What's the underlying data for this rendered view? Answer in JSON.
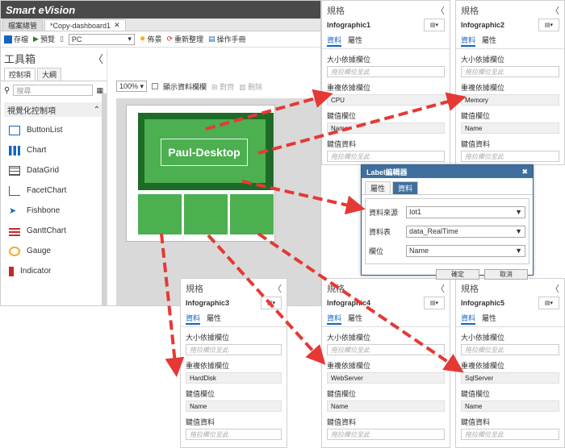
{
  "app": {
    "title": "Smart eVision",
    "tabs": [
      "檔案總管",
      "*Copy-dashboard1"
    ],
    "toolbar": {
      "save": "存檔",
      "preview": "預覽",
      "device": "PC",
      "theme": "佈景",
      "resort": "重新整理",
      "manual": "操作手冊"
    },
    "toolbox": {
      "title": "工具箱",
      "collapse": "〈",
      "tabs": [
        "控制項",
        "大綱"
      ],
      "search_placeholder": "搜尋",
      "section": "視覺化控制項",
      "items": [
        "ButtonList",
        "Chart",
        "DataGrid",
        "FacetChart",
        "Fishbone",
        "GanttChart",
        "Gauge",
        "Indicator"
      ]
    },
    "canvas": {
      "zoom": "100%",
      "show_grid": "顯示資料欄欄",
      "align": "對齊",
      "delete": "刪除",
      "tile_label": "Paul-Desktop"
    }
  },
  "panels": [
    {
      "title": "規格",
      "comp": "Infographic1",
      "tabs": [
        "資料",
        "屬性"
      ],
      "size_label": "大小依據欄位",
      "size_ph": "拖拉欄位至此",
      "weight_label": "重複依據欄位",
      "weight_value": "CPU",
      "key_label": "鍵值欄位",
      "key_value": "Name",
      "keydata_label": "鍵值資料",
      "keydata_ph": "拖拉欄位至此"
    },
    {
      "title": "規格",
      "comp": "Infographic2",
      "tabs": [
        "資料",
        "屬性"
      ],
      "size_label": "大小依據欄位",
      "size_ph": "拖拉欄位至此",
      "weight_label": "重複依據欄位",
      "weight_value": "Memory",
      "key_label": "鍵值欄位",
      "key_value": "Name",
      "keydata_label": "鍵值資料",
      "keydata_ph": "拖拉欄位至此"
    },
    {
      "title": "規格",
      "comp": "Infographic3",
      "tabs": [
        "資料",
        "屬性"
      ],
      "size_label": "大小依據欄位",
      "size_ph": "拖拉欄位至此",
      "weight_label": "重複依據欄位",
      "weight_value": "HardDisk",
      "key_label": "鍵值欄位",
      "key_value": "Name",
      "keydata_label": "鍵值資料",
      "keydata_ph": "拖拉欄位至此"
    },
    {
      "title": "規格",
      "comp": "Infographic4",
      "tabs": [
        "資料",
        "屬性"
      ],
      "size_label": "大小依據欄位",
      "size_ph": "拖拉欄位至此",
      "weight_label": "重複依據欄位",
      "weight_value": "WebServer",
      "key_label": "鍵值欄位",
      "key_value": "Name",
      "keydata_label": "鍵值資料",
      "keydata_ph": "拖拉欄位至此"
    },
    {
      "title": "規格",
      "comp": "Infographic5",
      "tabs": [
        "資料",
        "屬性"
      ],
      "size_label": "大小依據欄位",
      "size_ph": "拖拉欄位至此",
      "weight_label": "重複依據欄位",
      "weight_value": "SqlServer",
      "key_label": "鍵值欄位",
      "key_value": "Name",
      "keydata_label": "鍵值資料",
      "keydata_ph": "拖拉欄位至此"
    }
  ],
  "dialog": {
    "title": "Label編輯器",
    "tabs": [
      "屬性",
      "資料"
    ],
    "source_label": "資料來源",
    "source_value": "Iot1",
    "table_label": "資料表",
    "table_value": "data_RealTime",
    "field_label": "欄位",
    "field_value": "Name",
    "ok": "確定",
    "cancel": "取消"
  },
  "colors": {
    "tile_dark": "#1e6b27",
    "tile": "#4caf50",
    "arrow": "#e53935",
    "accent": "#1565c0"
  }
}
